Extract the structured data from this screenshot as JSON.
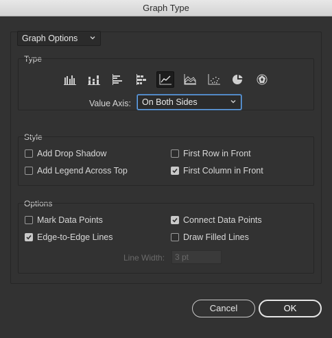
{
  "window": {
    "title": "Graph Type"
  },
  "graph_options_dropdown": {
    "value": "Graph Options"
  },
  "type_group": {
    "label": "Type",
    "icons": [
      {
        "name": "grouped-column-icon",
        "selected": false
      },
      {
        "name": "stacked-column-icon",
        "selected": false
      },
      {
        "name": "grouped-bar-icon",
        "selected": false
      },
      {
        "name": "stacked-bar-icon",
        "selected": false
      },
      {
        "name": "line-graph-icon",
        "selected": true
      },
      {
        "name": "area-graph-icon",
        "selected": false
      },
      {
        "name": "scatter-graph-icon",
        "selected": false
      },
      {
        "name": "pie-graph-icon",
        "selected": false
      },
      {
        "name": "radar-graph-icon",
        "selected": false
      }
    ],
    "value_axis_label": "Value Axis:",
    "value_axis_value": "On Both Sides"
  },
  "style_group": {
    "label": "Style",
    "add_drop_shadow": {
      "label": "Add Drop Shadow",
      "checked": false
    },
    "first_row_in_front": {
      "label": "First Row in Front",
      "checked": false
    },
    "add_legend_across_top": {
      "label": "Add Legend Across Top",
      "checked": false
    },
    "first_column_in_front": {
      "label": "First Column in Front",
      "checked": true
    }
  },
  "options_group": {
    "label": "Options",
    "mark_data_points": {
      "label": "Mark Data Points",
      "checked": false
    },
    "connect_data_points": {
      "label": "Connect Data Points",
      "checked": true
    },
    "edge_to_edge_lines": {
      "label": "Edge-to-Edge Lines",
      "checked": true
    },
    "draw_filled_lines": {
      "label": "Draw Filled Lines",
      "checked": false
    },
    "line_width_label": "Line Width:",
    "line_width_value": "3 pt"
  },
  "buttons": {
    "cancel": "Cancel",
    "ok": "OK"
  }
}
